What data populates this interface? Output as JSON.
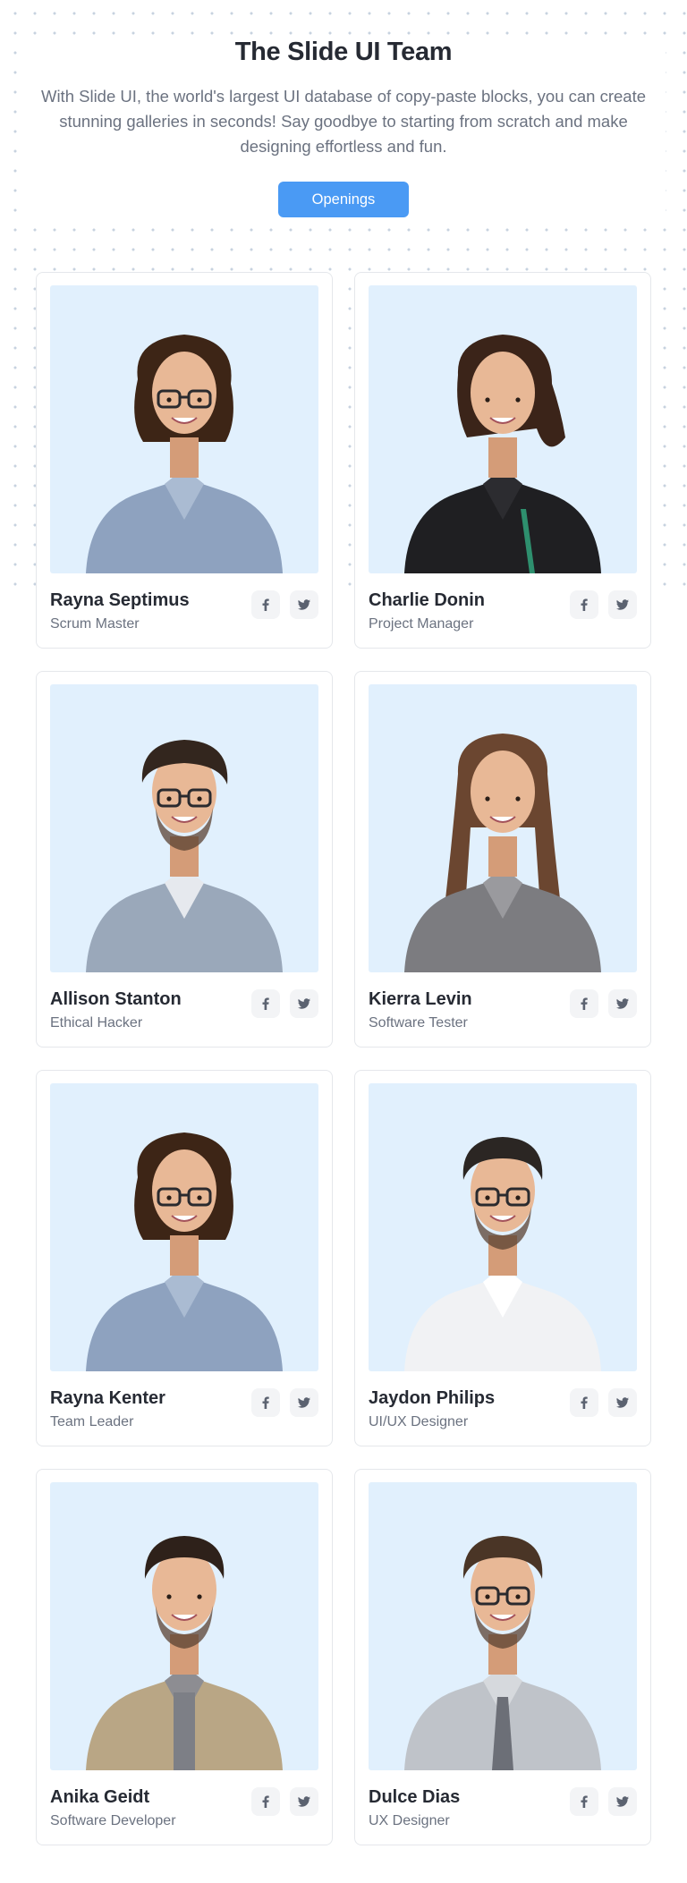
{
  "hero": {
    "title": "The Slide UI Team",
    "subtitle": "With Slide UI, the world's largest UI database of copy-paste blocks, you can create stunning galleries in seconds! Say goodbye to starting from scratch and make designing effortless and fun.",
    "cta_label": "Openings"
  },
  "colors": {
    "accent": "#4a9af4",
    "photo_bg": "#e1f0fd",
    "icon": "#5b6270"
  },
  "members": [
    {
      "name": "Rayna Septimus",
      "role": "Scrum Master",
      "photo": "woman-glasses-curly-hair",
      "socials": [
        "facebook-icon",
        "twitter-icon"
      ]
    },
    {
      "name": "Charlie Donin",
      "role": "Project Manager",
      "photo": "woman-ponytail-black-shirt",
      "socials": [
        "facebook-icon",
        "twitter-icon"
      ]
    },
    {
      "name": "Allison Stanton",
      "role": "Ethical Hacker",
      "photo": "man-glasses-smiling",
      "socials": [
        "facebook-icon",
        "twitter-icon"
      ]
    },
    {
      "name": "Kierra Levin",
      "role": "Software Tester",
      "photo": "woman-long-hair-gray-shirt",
      "socials": [
        "facebook-icon",
        "twitter-icon"
      ]
    },
    {
      "name": "Rayna Kenter",
      "role": "Team Leader",
      "photo": "woman-glasses-curly-hair",
      "socials": [
        "facebook-icon",
        "twitter-icon"
      ]
    },
    {
      "name": "Jaydon Philips",
      "role": "UI/UX Designer",
      "photo": "man-glasses-beard-white-shirt",
      "socials": [
        "facebook-icon",
        "twitter-icon"
      ]
    },
    {
      "name": "Anika Geidt",
      "role": "Software Developer",
      "photo": "man-beard-jacket",
      "socials": [
        "facebook-icon",
        "twitter-icon"
      ]
    },
    {
      "name": "Dulce Dias",
      "role": "UX Designer",
      "photo": "man-glasses-tie",
      "socials": [
        "facebook-icon",
        "twitter-icon"
      ]
    }
  ]
}
